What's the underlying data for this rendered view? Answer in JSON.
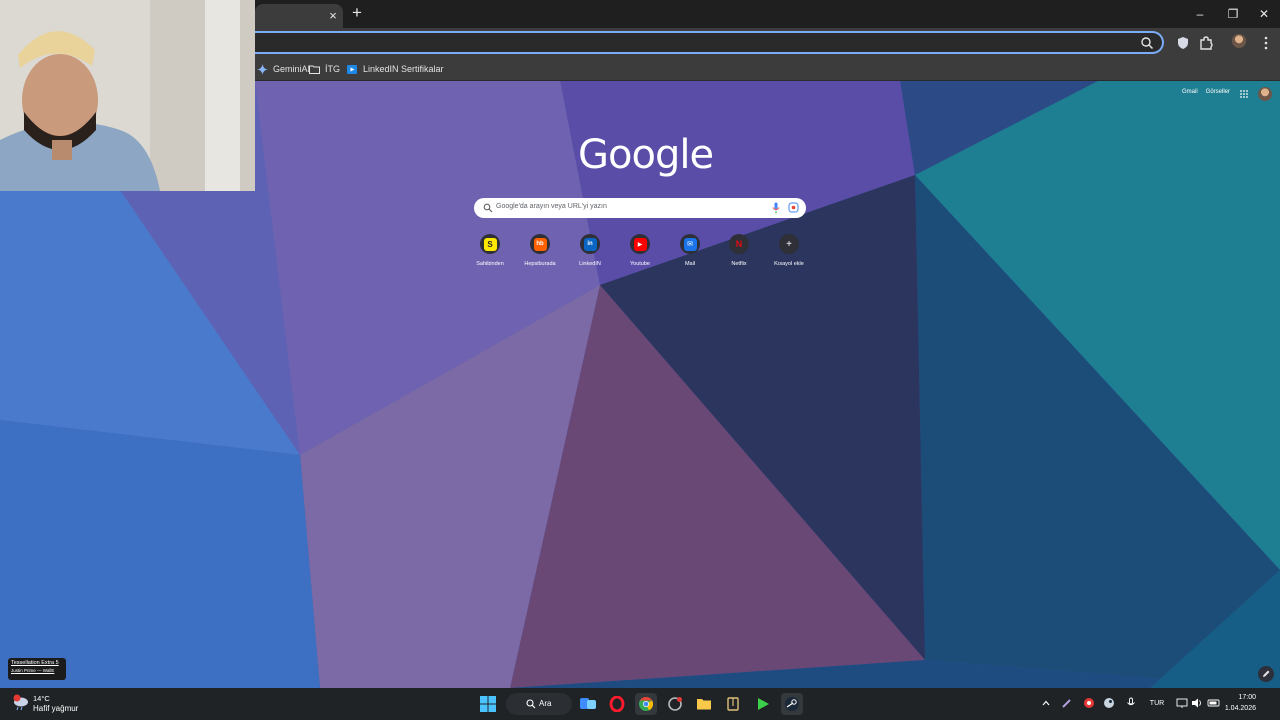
{
  "browser": {
    "tab_close": "×",
    "new_tab": "+",
    "window_controls": {
      "minimize": "–",
      "maximize": "❐",
      "close": "✕"
    },
    "bookmarks": [
      {
        "label": "GeminiAI",
        "icon": "gemini-icon"
      },
      {
        "label": "İTG",
        "icon": "folder-icon"
      },
      {
        "label": "LinkedIN Sertifikalar",
        "icon": "linkedin-bookmark-icon"
      }
    ]
  },
  "ntp": {
    "top_links": {
      "gmail": "Gmail",
      "images": "Görseller"
    },
    "logo_text": "Google",
    "search_placeholder": "Google'da arayın veya URL'yi yazın",
    "shortcuts": [
      {
        "label": "Sahibinden",
        "glyph": "S",
        "color": "#ffe800",
        "glyph_color": "#222"
      },
      {
        "label": "Hepsiburada",
        "glyph": "hb",
        "color": "#ff6000",
        "glyph_color": "#fff"
      },
      {
        "label": "LinkedIN",
        "glyph": "in",
        "color": "#0a66c2",
        "glyph_color": "#fff"
      },
      {
        "label": "Youtube",
        "glyph": "▶",
        "color": "#ff0000",
        "glyph_color": "#fff"
      },
      {
        "label": "Mail",
        "glyph": "✉",
        "color": "#1a73e8",
        "glyph_color": "#fff"
      },
      {
        "label": "Netflix",
        "glyph": "N",
        "color": "#2f2f38",
        "glyph_color": "#e50914"
      },
      {
        "label": "Kısayol ekle",
        "glyph": "+",
        "color": "#2f2f38",
        "glyph_color": "#fff"
      }
    ]
  },
  "now_playing": {
    "title": "Tessellation Extra 5",
    "subtitle": "Justin Prime — WallE"
  },
  "taskbar": {
    "weather_temp": "14°C",
    "weather_desc": "Hafif yağmur",
    "search_label": "Ara",
    "lang": "TUR",
    "time": "17:00",
    "date": "1.04.2026"
  }
}
